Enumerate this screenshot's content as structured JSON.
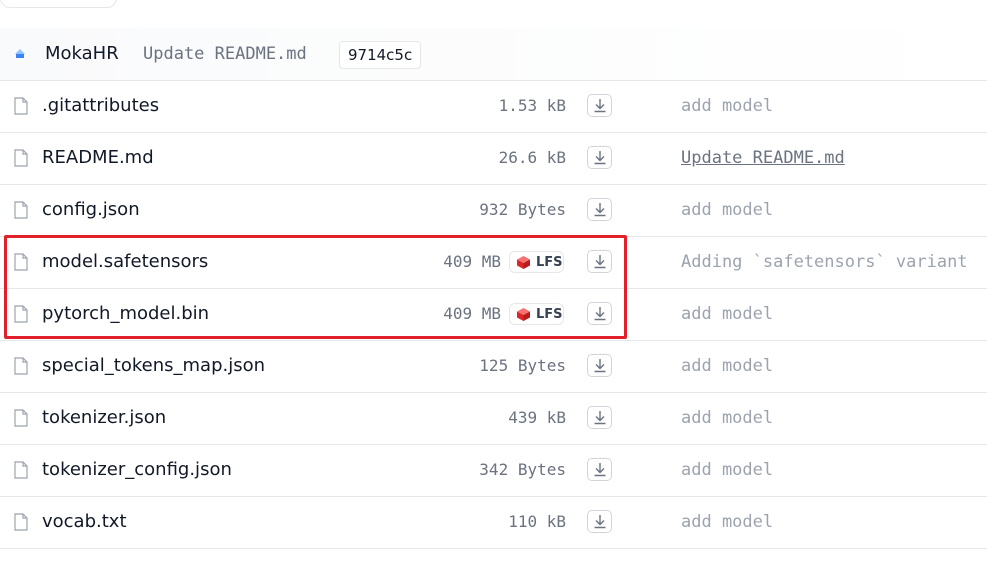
{
  "header": {
    "org_name": "MokaHR",
    "last_commit_message": "Update README.md",
    "commit_hash": "9714c5c"
  },
  "files": [
    {
      "name": ".gitattributes",
      "size": "1.53 kB",
      "lfs": false,
      "commit": "add model"
    },
    {
      "name": "README.md",
      "size": "26.6 kB",
      "lfs": false,
      "commit": "Update README.md"
    },
    {
      "name": "config.json",
      "size": "932 Bytes",
      "lfs": false,
      "commit": "add model"
    },
    {
      "name": "model.safetensors",
      "size": "409 MB",
      "lfs": true,
      "lfs_label": "LFS",
      "commit": "Adding `safetensors` variant"
    },
    {
      "name": "pytorch_model.bin",
      "size": "409 MB",
      "lfs": true,
      "lfs_label": "LFS",
      "commit": "add model"
    },
    {
      "name": "special_tokens_map.json",
      "size": "125 Bytes",
      "lfs": false,
      "commit": "add model"
    },
    {
      "name": "tokenizer.json",
      "size": "439 kB",
      "lfs": false,
      "commit": "add model"
    },
    {
      "name": "tokenizer_config.json",
      "size": "342 Bytes",
      "lfs": false,
      "commit": "add model"
    },
    {
      "name": "vocab.txt",
      "size": "110 kB",
      "lfs": false,
      "commit": "add model"
    }
  ],
  "colors": {
    "highlight": "#e0212c",
    "lfs_cube": "#dc2626"
  },
  "icons": {
    "file": "file-icon",
    "download": "download-icon",
    "lfs": "lfs-cube-icon",
    "org": "org-icon"
  }
}
